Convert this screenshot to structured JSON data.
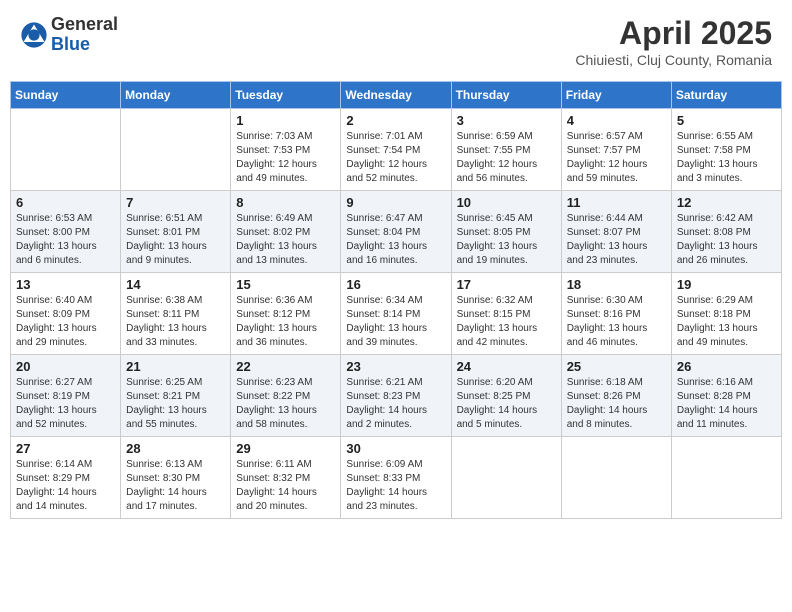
{
  "logo": {
    "general": "General",
    "blue": "Blue"
  },
  "title": "April 2025",
  "location": "Chiuiesti, Cluj County, Romania",
  "days_of_week": [
    "Sunday",
    "Monday",
    "Tuesday",
    "Wednesday",
    "Thursday",
    "Friday",
    "Saturday"
  ],
  "weeks": [
    [
      {
        "day": "",
        "info": ""
      },
      {
        "day": "",
        "info": ""
      },
      {
        "day": "1",
        "info": "Sunrise: 7:03 AM\nSunset: 7:53 PM\nDaylight: 12 hours and 49 minutes."
      },
      {
        "day": "2",
        "info": "Sunrise: 7:01 AM\nSunset: 7:54 PM\nDaylight: 12 hours and 52 minutes."
      },
      {
        "day": "3",
        "info": "Sunrise: 6:59 AM\nSunset: 7:55 PM\nDaylight: 12 hours and 56 minutes."
      },
      {
        "day": "4",
        "info": "Sunrise: 6:57 AM\nSunset: 7:57 PM\nDaylight: 12 hours and 59 minutes."
      },
      {
        "day": "5",
        "info": "Sunrise: 6:55 AM\nSunset: 7:58 PM\nDaylight: 13 hours and 3 minutes."
      }
    ],
    [
      {
        "day": "6",
        "info": "Sunrise: 6:53 AM\nSunset: 8:00 PM\nDaylight: 13 hours and 6 minutes."
      },
      {
        "day": "7",
        "info": "Sunrise: 6:51 AM\nSunset: 8:01 PM\nDaylight: 13 hours and 9 minutes."
      },
      {
        "day": "8",
        "info": "Sunrise: 6:49 AM\nSunset: 8:02 PM\nDaylight: 13 hours and 13 minutes."
      },
      {
        "day": "9",
        "info": "Sunrise: 6:47 AM\nSunset: 8:04 PM\nDaylight: 13 hours and 16 minutes."
      },
      {
        "day": "10",
        "info": "Sunrise: 6:45 AM\nSunset: 8:05 PM\nDaylight: 13 hours and 19 minutes."
      },
      {
        "day": "11",
        "info": "Sunrise: 6:44 AM\nSunset: 8:07 PM\nDaylight: 13 hours and 23 minutes."
      },
      {
        "day": "12",
        "info": "Sunrise: 6:42 AM\nSunset: 8:08 PM\nDaylight: 13 hours and 26 minutes."
      }
    ],
    [
      {
        "day": "13",
        "info": "Sunrise: 6:40 AM\nSunset: 8:09 PM\nDaylight: 13 hours and 29 minutes."
      },
      {
        "day": "14",
        "info": "Sunrise: 6:38 AM\nSunset: 8:11 PM\nDaylight: 13 hours and 33 minutes."
      },
      {
        "day": "15",
        "info": "Sunrise: 6:36 AM\nSunset: 8:12 PM\nDaylight: 13 hours and 36 minutes."
      },
      {
        "day": "16",
        "info": "Sunrise: 6:34 AM\nSunset: 8:14 PM\nDaylight: 13 hours and 39 minutes."
      },
      {
        "day": "17",
        "info": "Sunrise: 6:32 AM\nSunset: 8:15 PM\nDaylight: 13 hours and 42 minutes."
      },
      {
        "day": "18",
        "info": "Sunrise: 6:30 AM\nSunset: 8:16 PM\nDaylight: 13 hours and 46 minutes."
      },
      {
        "day": "19",
        "info": "Sunrise: 6:29 AM\nSunset: 8:18 PM\nDaylight: 13 hours and 49 minutes."
      }
    ],
    [
      {
        "day": "20",
        "info": "Sunrise: 6:27 AM\nSunset: 8:19 PM\nDaylight: 13 hours and 52 minutes."
      },
      {
        "day": "21",
        "info": "Sunrise: 6:25 AM\nSunset: 8:21 PM\nDaylight: 13 hours and 55 minutes."
      },
      {
        "day": "22",
        "info": "Sunrise: 6:23 AM\nSunset: 8:22 PM\nDaylight: 13 hours and 58 minutes."
      },
      {
        "day": "23",
        "info": "Sunrise: 6:21 AM\nSunset: 8:23 PM\nDaylight: 14 hours and 2 minutes."
      },
      {
        "day": "24",
        "info": "Sunrise: 6:20 AM\nSunset: 8:25 PM\nDaylight: 14 hours and 5 minutes."
      },
      {
        "day": "25",
        "info": "Sunrise: 6:18 AM\nSunset: 8:26 PM\nDaylight: 14 hours and 8 minutes."
      },
      {
        "day": "26",
        "info": "Sunrise: 6:16 AM\nSunset: 8:28 PM\nDaylight: 14 hours and 11 minutes."
      }
    ],
    [
      {
        "day": "27",
        "info": "Sunrise: 6:14 AM\nSunset: 8:29 PM\nDaylight: 14 hours and 14 minutes."
      },
      {
        "day": "28",
        "info": "Sunrise: 6:13 AM\nSunset: 8:30 PM\nDaylight: 14 hours and 17 minutes."
      },
      {
        "day": "29",
        "info": "Sunrise: 6:11 AM\nSunset: 8:32 PM\nDaylight: 14 hours and 20 minutes."
      },
      {
        "day": "30",
        "info": "Sunrise: 6:09 AM\nSunset: 8:33 PM\nDaylight: 14 hours and 23 minutes."
      },
      {
        "day": "",
        "info": ""
      },
      {
        "day": "",
        "info": ""
      },
      {
        "day": "",
        "info": ""
      }
    ]
  ]
}
